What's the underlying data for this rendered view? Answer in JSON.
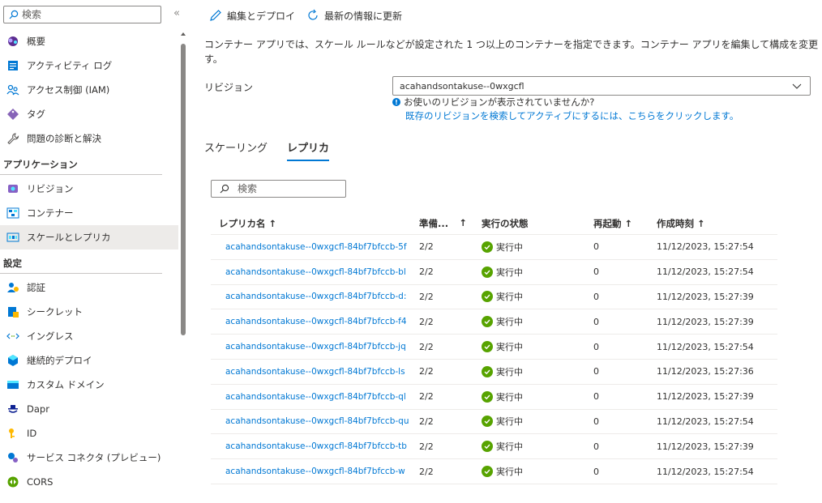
{
  "sidebar": {
    "search_placeholder": "検索",
    "collapse_label": "«",
    "items_top": [
      {
        "label": "概要",
        "icon": "overview-icon"
      },
      {
        "label": "アクティビティ ログ",
        "icon": "activity-log-icon"
      },
      {
        "label": "アクセス制御 (IAM)",
        "icon": "access-control-icon"
      },
      {
        "label": "タグ",
        "icon": "tag-icon"
      },
      {
        "label": "問題の診断と解決",
        "icon": "wrench-icon"
      }
    ],
    "section_app": "アプリケーション",
    "items_app": [
      {
        "label": "リビジョン",
        "icon": "revision-icon"
      },
      {
        "label": "コンテナー",
        "icon": "container-icon"
      },
      {
        "label": "スケールとレプリカ",
        "icon": "scale-icon"
      }
    ],
    "section_settings": "設定",
    "items_settings": [
      {
        "label": "認証",
        "icon": "auth-icon"
      },
      {
        "label": "シークレット",
        "icon": "secret-icon"
      },
      {
        "label": "イングレス",
        "icon": "ingress-icon"
      },
      {
        "label": "継続的デプロイ",
        "icon": "deploy-icon"
      },
      {
        "label": "カスタム ドメイン",
        "icon": "domain-icon"
      },
      {
        "label": "Dapr",
        "icon": "dapr-icon"
      },
      {
        "label": "ID",
        "icon": "identity-icon"
      },
      {
        "label": "サービス コネクタ (プレビュー)",
        "icon": "connector-icon"
      },
      {
        "label": "CORS",
        "icon": "cors-icon"
      }
    ]
  },
  "toolbar": {
    "edit_label": "編集とデプロイ",
    "refresh_label": "最新の情報に更新"
  },
  "main": {
    "description": "コンテナー アプリでは、スケール ルールなどが設定された 1 つ以上のコンテナーを指定できます。コンテナー アプリを編集して構成を変更す。",
    "revision_label": "リビジョン",
    "revision_value": "acahandsontakuse--0wxgcfl",
    "info_text": "お使いのリビジョンが表示されていませんか?",
    "info_link": "既存のリビジョンを検索してアクティブにするには、こちらをクリックします。",
    "tabs": [
      "スケーリング",
      "レプリカ"
    ],
    "grid_search_placeholder": "検索"
  },
  "grid": {
    "headers": {
      "name": "レプリカ名 ↑",
      "ready": "準備...",
      "ready_sort": "↑",
      "state": "実行の状態",
      "restart": "再起動 ↑",
      "created": "作成時刻 ↑"
    },
    "rows": [
      {
        "name": "acahandsontakuse--0wxgcfl-84bf7bfccb-5f",
        "ready": "2/2",
        "state": "実行中",
        "restart": "0",
        "created": "11/12/2023, 15:27:54"
      },
      {
        "name": "acahandsontakuse--0wxgcfl-84bf7bfccb-bl",
        "ready": "2/2",
        "state": "実行中",
        "restart": "0",
        "created": "11/12/2023, 15:27:54"
      },
      {
        "name": "acahandsontakuse--0wxgcfl-84bf7bfccb-d:",
        "ready": "2/2",
        "state": "実行中",
        "restart": "0",
        "created": "11/12/2023, 15:27:39"
      },
      {
        "name": "acahandsontakuse--0wxgcfl-84bf7bfccb-f4",
        "ready": "2/2",
        "state": "実行中",
        "restart": "0",
        "created": "11/12/2023, 15:27:39"
      },
      {
        "name": "acahandsontakuse--0wxgcfl-84bf7bfccb-jq",
        "ready": "2/2",
        "state": "実行中",
        "restart": "0",
        "created": "11/12/2023, 15:27:54"
      },
      {
        "name": "acahandsontakuse--0wxgcfl-84bf7bfccb-ls",
        "ready": "2/2",
        "state": "実行中",
        "restart": "0",
        "created": "11/12/2023, 15:27:36"
      },
      {
        "name": "acahandsontakuse--0wxgcfl-84bf7bfccb-ql",
        "ready": "2/2",
        "state": "実行中",
        "restart": "0",
        "created": "11/12/2023, 15:27:39"
      },
      {
        "name": "acahandsontakuse--0wxgcfl-84bf7bfccb-qu",
        "ready": "2/2",
        "state": "実行中",
        "restart": "0",
        "created": "11/12/2023, 15:27:54"
      },
      {
        "name": "acahandsontakuse--0wxgcfl-84bf7bfccb-tb",
        "ready": "2/2",
        "state": "実行中",
        "restart": "0",
        "created": "11/12/2023, 15:27:39"
      },
      {
        "name": "acahandsontakuse--0wxgcfl-84bf7bfccb-w",
        "ready": "2/2",
        "state": "実行中",
        "restart": "0",
        "created": "11/12/2023, 15:27:54"
      }
    ]
  },
  "colors": {
    "accent": "#0078d4",
    "running": "#57a300",
    "active_bg": "#edebe9"
  }
}
